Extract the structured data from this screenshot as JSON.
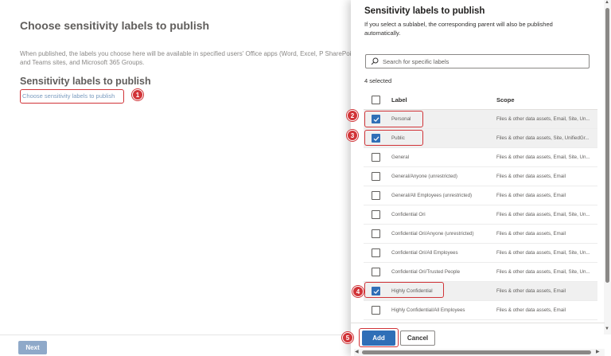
{
  "background": {
    "title": "Choose sensitivity labels to publish",
    "description": "When published, the labels you choose here will be available in specified users' Office apps (Word, Excel, P SharePoint and Teams sites, and Microsoft 365 Groups.",
    "subtitle": "Sensitivity labels to publish",
    "choose_link": "Choose sensitivity labels to publish",
    "next_button": "Next"
  },
  "panel": {
    "title": "Sensitivity labels to publish",
    "description": "If you select a sublabel, the corresponding parent will also be published automatically.",
    "search_placeholder": "Search for specific labels",
    "selected_count": "4 selected",
    "columns": {
      "label": "Label",
      "scope": "Scope"
    },
    "rows": [
      {
        "label": "Personal",
        "scope": "Files & other data assets, Email, Site, Un...",
        "checked": true
      },
      {
        "label": "Public",
        "scope": "Files & other data assets, Site, UnifiedGr...",
        "checked": true
      },
      {
        "label": "General",
        "scope": "Files & other data assets, Email, Site, Un...",
        "checked": false
      },
      {
        "label": "General/Anyone (unrestricted)",
        "scope": "Files & other data assets, Email",
        "checked": false
      },
      {
        "label": "General/All Employees (unrestricted)",
        "scope": "Files & other data assets, Email",
        "checked": false
      },
      {
        "label": "Confidential Ori",
        "scope": "Files & other data assets, Email, Site, Un...",
        "checked": false
      },
      {
        "label": "Confidential Ori/Anyone (unrestricted)",
        "scope": "Files & other data assets, Email",
        "checked": false
      },
      {
        "label": "Confidential Ori/All Employees",
        "scope": "Files & other data assets, Email, Site, Un...",
        "checked": false
      },
      {
        "label": "Confidential Ori/Trusted People",
        "scope": "Files & other data assets, Email, Site, Un...",
        "checked": false
      },
      {
        "label": "Highly Confidential",
        "scope": "Files & other data assets, Email",
        "checked": true
      },
      {
        "label": "Highly Confidential/All Employees",
        "scope": "Files & other data assets, Email",
        "checked": false
      }
    ],
    "add_button": "Add",
    "cancel_button": "Cancel"
  },
  "callouts": [
    "1",
    "2",
    "3",
    "4",
    "5"
  ],
  "colors": {
    "accent": "#2f6fb7",
    "callout": "#d13438",
    "selected_row": "#f0f0f0"
  },
  "icons": {
    "search": "search-icon",
    "checkmark": "checkmark-icon"
  }
}
